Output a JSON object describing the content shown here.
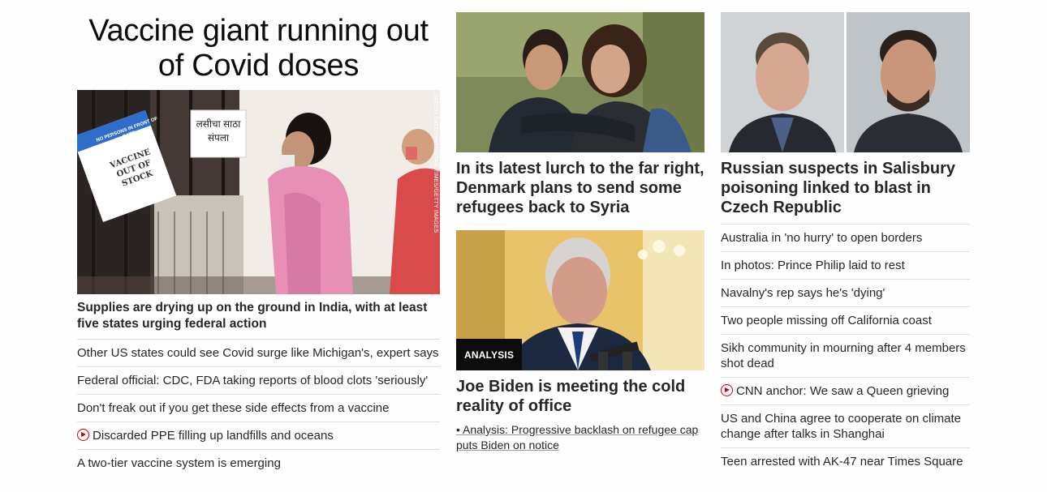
{
  "column1": {
    "banner_headline": "Vaccine giant running out of Covid doses",
    "image_credit": "SATISH BATE/HINDUSTAN TIMES/GETTY IMAGES",
    "sign_text": "VACCINE OUT OF STOCK",
    "sign_header": "NO PERSONS IN FRONT OF GATE",
    "hindi_sign": "लसीचा साठा संपला",
    "headline": "Supplies are drying up on the ground in India, with at least five states urging federal action",
    "links": [
      {
        "text": "Other US states could see Covid surge like Michigan's, expert says",
        "video": false
      },
      {
        "text": "Federal official: CDC, FDA taking reports of blood clots 'seriously'",
        "video": false
      },
      {
        "text": "Don't freak out if you get these side effects from a vaccine",
        "video": false
      },
      {
        "text": "Discarded PPE filling up landfills and oceans",
        "video": true
      },
      {
        "text": "A two-tier vaccine system is emerging",
        "video": false
      }
    ]
  },
  "column2": {
    "story1_headline": "In its latest lurch to the far right, Denmark plans to send some refugees back to Syria",
    "badge": "ANALYSIS",
    "story2_headline": "Joe Biden is meeting the cold reality of office",
    "story2_sublink": "• Analysis: Progressive backlash on refugee cap puts Biden on notice"
  },
  "column3": {
    "headline": "Russian suspects in Salisbury poisoning linked to blast in Czech Republic",
    "links": [
      {
        "text": "Australia in 'no hurry' to open borders",
        "video": false
      },
      {
        "text": "In photos: Prince Philip laid to rest",
        "video": false
      },
      {
        "text": "Navalny's rep says he's 'dying'",
        "video": false
      },
      {
        "text": "Two people missing off California coast",
        "video": false
      },
      {
        "text": "Sikh community in mourning after 4 members shot dead",
        "video": false
      },
      {
        "text": "CNN anchor: We saw a Queen grieving",
        "video": true
      },
      {
        "text": "US and China agree to cooperate on climate change after talks in Shanghai",
        "video": false
      },
      {
        "text": "Teen arrested with AK-47 near Times Square",
        "video": false
      }
    ]
  },
  "colors": {
    "text": "#262626",
    "video_red": "#cc0000",
    "divider": "#dedede",
    "badge_bg": "#0c0c0c"
  }
}
